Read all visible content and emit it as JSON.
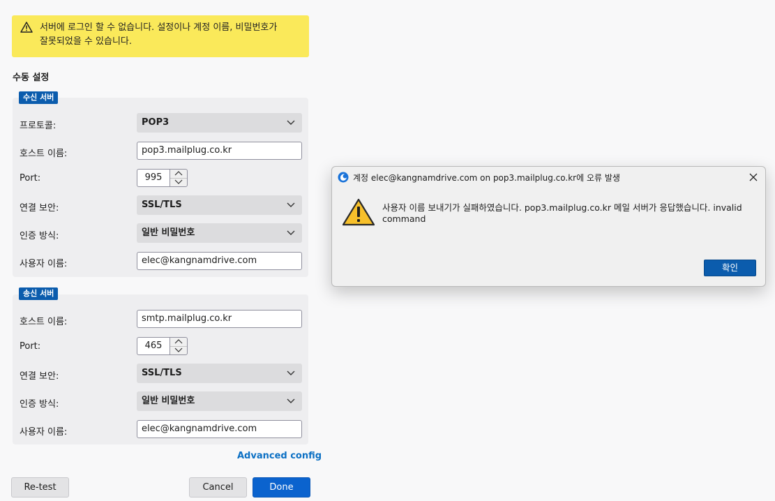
{
  "warning": {
    "icon": "warning-triangle-icon",
    "line1": "서버에 로그인 할 수 없습니다. 설정이나 계정 이름, 비밀번호가",
    "line2": "잘못되었을 수 있습니다."
  },
  "manual_setup": {
    "title": "수동 설정",
    "incoming": {
      "badge": "수신 서버",
      "protocol_label": "프로토콜:",
      "protocol_value": "POP3",
      "hostname_label": "호스트 이름:",
      "hostname_value": "pop3.mailplug.co.kr",
      "port_label": "Port:",
      "port_value": "995",
      "security_label": "연결 보안:",
      "security_value": "SSL/TLS",
      "auth_label": "인증 방식:",
      "auth_value": "일반 비밀번호",
      "username_label": "사용자 이름:",
      "username_value": "elec@kangnamdrive.com"
    },
    "outgoing": {
      "badge": "송신 서버",
      "hostname_label": "호스트 이름:",
      "hostname_value": "smtp.mailplug.co.kr",
      "port_label": "Port:",
      "port_value": "465",
      "security_label": "연결 보안:",
      "security_value": "SSL/TLS",
      "auth_label": "인증 방식:",
      "auth_value": "일반 비밀번호",
      "username_label": "사용자 이름:",
      "username_value": "elec@kangnamdrive.com"
    },
    "advanced_link": "Advanced config"
  },
  "buttons": {
    "retest": "Re-test",
    "cancel": "Cancel",
    "done": "Done"
  },
  "dialog": {
    "title": "계정 elec@kangnamdrive.com on pop3.mailplug.co.kr에 오류 발생",
    "message_line1": "사용자 이름 보내기가 실패하였습니다. pop3.mailplug.co.kr 메일 서버가 응답했습니다. invalid",
    "message_line2": "command",
    "ok": "확인"
  },
  "colors": {
    "banner_bg": "#fae95a",
    "badge_bg": "#0b5cad",
    "primary": "#0b63ce",
    "link": "#0c70c4"
  }
}
